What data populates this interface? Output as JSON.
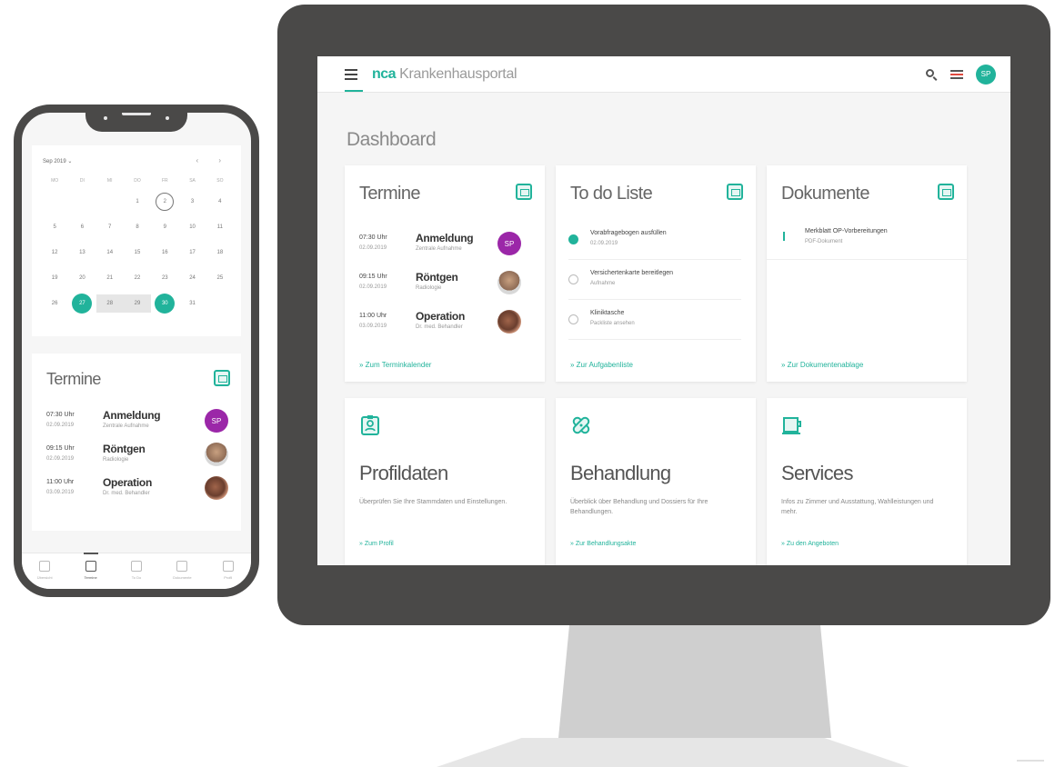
{
  "app": {
    "brand": "nca",
    "brand_suffix": "Krankenhausportal",
    "avatar_initials": "SP",
    "page_title": "Dashboard",
    "accent_color": "#21b39b"
  },
  "termine": {
    "title": "Termine",
    "link": "» Zum Terminkalender",
    "items": [
      {
        "time": "07:30 Uhr",
        "date": "02.09.2019",
        "name": "Anmeldung",
        "sub": "Zentrale Aufnahme",
        "avatar": "SP"
      },
      {
        "time": "09:15 Uhr",
        "date": "02.09.2019",
        "name": "Röntgen",
        "sub": "Radiologie",
        "avatar": ""
      },
      {
        "time": "11:00 Uhr",
        "date": "03.09.2019",
        "name": "Operation",
        "sub": "Dr. med. Behandler",
        "avatar": ""
      }
    ]
  },
  "todo": {
    "title": "To do Liste",
    "link": "» Zur Aufgabenliste",
    "items": [
      {
        "text": "Vorabfragebogen ausfüllen",
        "sub": "02.09.2019",
        "done": true
      },
      {
        "text": "Versichertenkarte bereitlegen",
        "sub": "Aufnahme",
        "done": false
      },
      {
        "text": "Kliniktasche",
        "sub": "Packliste ansehen",
        "done": false
      }
    ]
  },
  "dokumente": {
    "title": "Dokumente",
    "link": "» Zur Dokumentenablage",
    "items": [
      {
        "text": "Merkblatt OP-Vorbereitungen",
        "sub": "PDF-Dokument"
      }
    ]
  },
  "tiles": [
    {
      "title": "Profildaten",
      "desc": "Überprüfen Sie Ihre Stammdaten und Einstellungen.",
      "link": "» Zum Profil",
      "icon": "profile-icon"
    },
    {
      "title": "Behandlung",
      "desc": "Überblick über Behandlung und Dossiers für Ihre Behandlungen.",
      "link": "» Zur Behandlungsakte",
      "icon": "bandage-icon"
    },
    {
      "title": "Services",
      "desc": "Infos zu Zimmer und Ausstattung, Wahlleistungen und mehr.",
      "link": "» Zu den Angeboten",
      "icon": "service-icon"
    }
  ],
  "phone": {
    "month": "Sep 2019 ⌄",
    "nav": "‹ ›",
    "weekdays": [
      "MO",
      "DI",
      "MI",
      "DO",
      "FR",
      "SA",
      "SO"
    ],
    "days": [
      "",
      "",
      "",
      "1",
      "2",
      "3",
      "4",
      "5",
      "6",
      "7",
      "8",
      "9",
      "10",
      "11",
      "12",
      "13",
      "14",
      "15",
      "16",
      "17",
      "18",
      "19",
      "20",
      "21",
      "22",
      "23",
      "24",
      "25",
      "26",
      "27",
      "28",
      "29",
      "30",
      "31",
      ""
    ],
    "today": "2",
    "selected": [
      "27",
      "30"
    ],
    "range": [
      "28",
      "29"
    ],
    "termine_title": "Termine",
    "tabs": [
      {
        "label": "Übersicht",
        "active": false
      },
      {
        "label": "Termine",
        "active": true
      },
      {
        "label": "To Do",
        "active": false
      },
      {
        "label": "Dokumente",
        "active": false
      },
      {
        "label": "Profil",
        "active": false
      }
    ]
  }
}
